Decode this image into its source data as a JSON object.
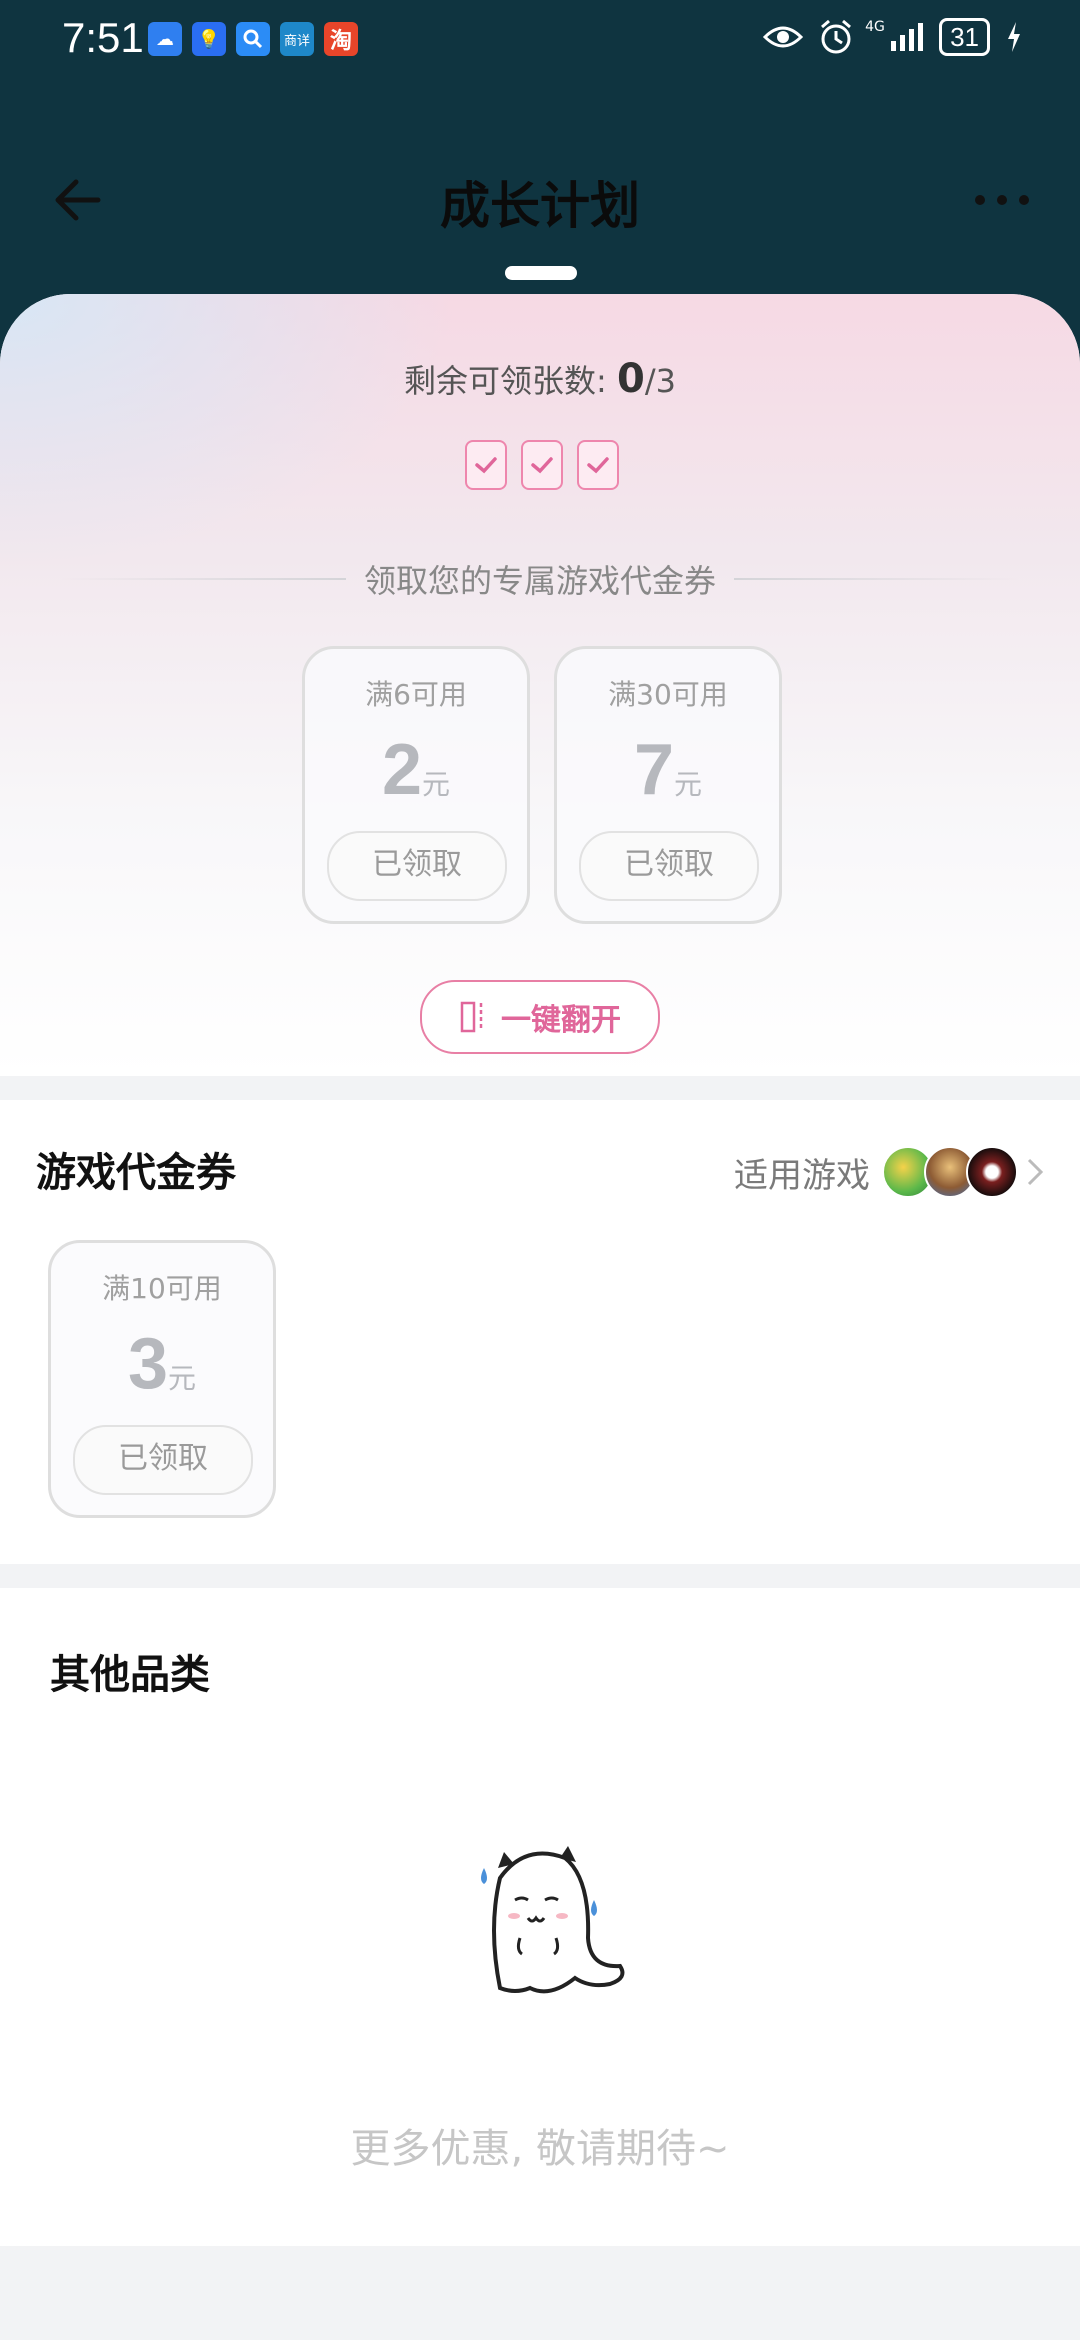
{
  "status_bar": {
    "time": "7:51",
    "app_icons": [
      "weather-icon",
      "bulb-icon",
      "search-app-icon",
      "news-app-icon",
      "taobao-icon"
    ],
    "app_icon_texts": [
      "",
      "",
      "",
      "商详",
      "淘"
    ],
    "network": "4G",
    "battery": "31"
  },
  "header": {
    "title": "成长计划"
  },
  "hero": {
    "remaining_label": "剩余可领张数: ",
    "remaining_count": "0",
    "remaining_total": "/3",
    "checked_boxes": 3,
    "section_title": "领取您的专属游戏代金券",
    "coupons": [
      {
        "condition": "满6可用",
        "amount": "2",
        "unit": "元",
        "status": "已领取"
      },
      {
        "condition": "满30可用",
        "amount": "7",
        "unit": "元",
        "status": "已领取"
      }
    ],
    "flip_button": "一键翻开"
  },
  "game_vouchers": {
    "title": "游戏代金券",
    "applicable_label": "适用游戏",
    "coupons": [
      {
        "condition": "满10可用",
        "amount": "3",
        "unit": "元",
        "status": "已领取"
      }
    ]
  },
  "other_categories": {
    "title": "其他品类",
    "empty_text": "更多优惠, 敬请期待~"
  },
  "colors": {
    "header_bg": "#0f3440",
    "accent_pink": "#e0669a",
    "coupon_gray": "#b6b8bd"
  }
}
